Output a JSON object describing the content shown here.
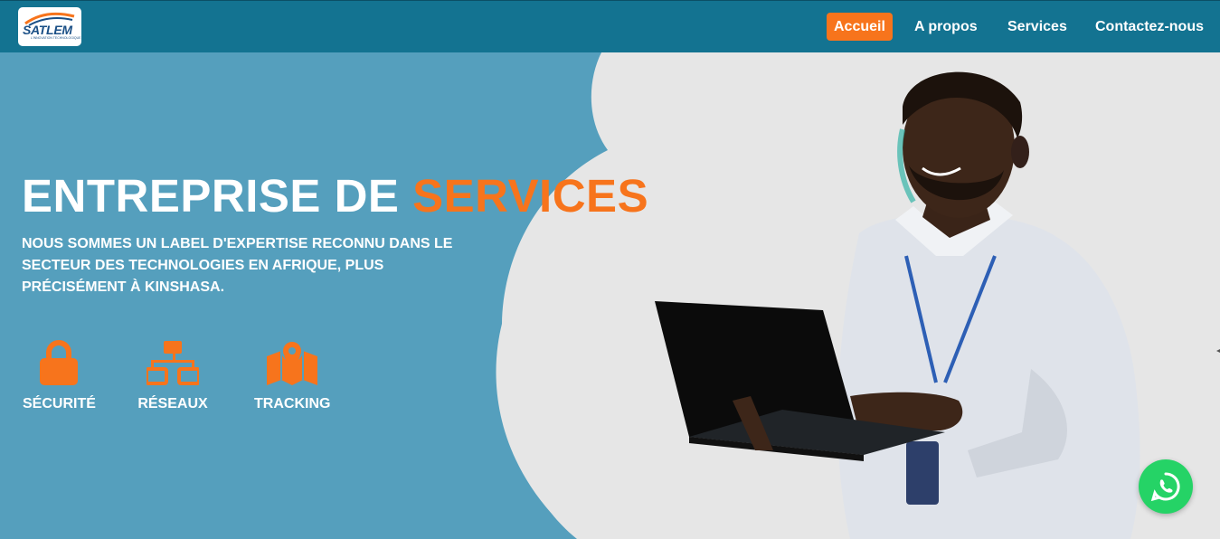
{
  "brand": {
    "logo_text": "SATLEM",
    "logo_tagline": "L'INNOVATION TECHNOLOGIQUE",
    "primary_color": "#137391",
    "accent_color": "#f7741c"
  },
  "nav": {
    "items": [
      {
        "label": "Accueil",
        "active": true
      },
      {
        "label": "A propos",
        "active": false
      },
      {
        "label": "Services",
        "active": false
      },
      {
        "label": "Contactez-nous",
        "active": false
      }
    ]
  },
  "hero": {
    "title_main": "ENTREPRISE DE ",
    "title_accent": "SERVICES",
    "subtitle": "NOUS SOMMES UN LABEL D'EXPERTISE RECONNU DANS LE SECTEUR DES TECHNOLOGIES EN AFRIQUE, PLUS PRÉCISÉMENT À KINSHASA.",
    "features": [
      {
        "label": "SÉCURITÉ",
        "icon": "lock-icon"
      },
      {
        "label": "RÉSEAUX",
        "icon": "network-icon"
      },
      {
        "label": "TRACKING",
        "icon": "map-pin-icon"
      }
    ]
  },
  "floating": {
    "whatsapp_icon": "whatsapp-icon",
    "whatsapp_color": "#25d366"
  }
}
